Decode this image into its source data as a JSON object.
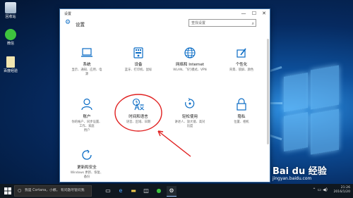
{
  "window": {
    "title": "设置",
    "header": "设置",
    "search_placeholder": "查找设置",
    "minimize": "—",
    "maximize": "☐",
    "close": "✕"
  },
  "tiles": [
    {
      "name": "系统",
      "desc1": "显示、通知、应用、电",
      "desc2": "源",
      "icon": "laptop-icon"
    },
    {
      "name": "设备",
      "desc1": "蓝牙、打印机、鼠标",
      "desc2": "",
      "icon": "keyboard-icon"
    },
    {
      "name": "网络和 Internet",
      "desc1": "WLAN、飞行模式、VPN",
      "desc2": "",
      "icon": "globe-icon"
    },
    {
      "name": "个性化",
      "desc1": "背景、锁屏、颜色",
      "desc2": "",
      "icon": "paint-icon"
    },
    {
      "name": "账户",
      "desc1": "你的帐户、同步设置、",
      "desc2": "工作、家庭",
      "desc3": "用户",
      "icon": "person-icon"
    },
    {
      "name": "时间和语言",
      "desc1": "语音、区域、日期",
      "desc2": "",
      "icon": "time-language-icon"
    },
    {
      "name": "轻松使用",
      "desc1": "讲述人、放大镜、高对",
      "desc2": "比度",
      "icon": "ease-of-access-icon"
    },
    {
      "name": "隐私",
      "desc1": "位置、相机",
      "desc2": "",
      "icon": "lock-icon"
    },
    {
      "name": "更新和安全",
      "desc1": "Windows 更新、恢复、",
      "desc2": "备份",
      "icon": "update-icon"
    }
  ],
  "desktop_icons": [
    {
      "label": "回收站",
      "icon": "recycle-bin-icon"
    },
    {
      "label": "微信",
      "icon": "wechat-icon"
    },
    {
      "label": "百度经验",
      "icon": "document-icon"
    }
  ],
  "taskbar": {
    "search_text": "有问题尽管问我",
    "search_prefix": "我是 Cortana，小娜。",
    "time": "21:26",
    "date": "2016/1/20"
  },
  "watermark": {
    "main": "Bai du 经验",
    "url": "jingyan.baidu.com"
  },
  "colors": {
    "accent": "#0a6cc5",
    "annotation": "#e02020",
    "taskbar": "#101820"
  }
}
